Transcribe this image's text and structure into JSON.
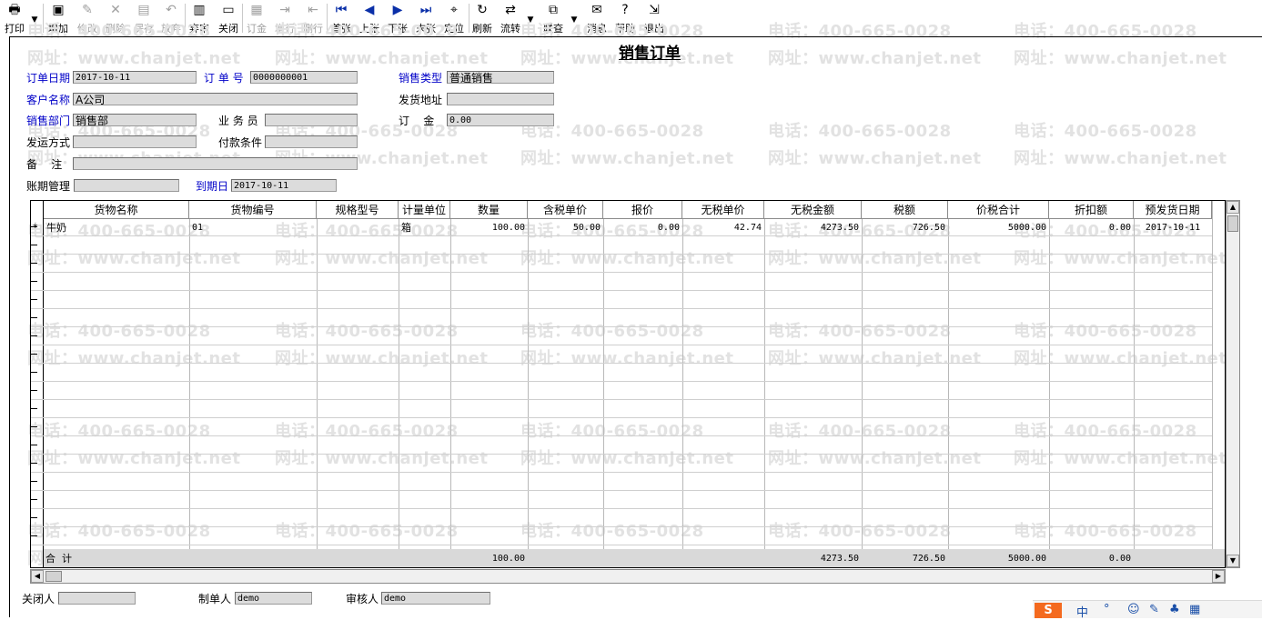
{
  "toolbar": {
    "buttons": [
      {
        "label": "打印",
        "icon": "printer-icon",
        "glyph": "🖶"
      },
      {
        "label": "增加",
        "icon": "add-doc-icon",
        "glyph": "▣"
      },
      {
        "label": "修改",
        "icon": "edit-icon",
        "glyph": "✎"
      },
      {
        "label": "删除",
        "icon": "delete-icon",
        "glyph": "✕"
      },
      {
        "label": "保存",
        "icon": "save-icon",
        "glyph": "▤"
      },
      {
        "label": "放弃",
        "icon": "undo-icon",
        "glyph": "↶"
      },
      {
        "label": "弃审",
        "icon": "unaudit-icon",
        "glyph": "▥"
      },
      {
        "label": "关闭",
        "icon": "open-folder-icon",
        "glyph": "▭"
      },
      {
        "label": "订金",
        "icon": "deposit-icon",
        "glyph": "▦"
      },
      {
        "label": "增行",
        "icon": "add-row-icon",
        "glyph": "⇥"
      },
      {
        "label": "删行",
        "icon": "delete-row-icon",
        "glyph": "⇤"
      },
      {
        "label": "首张",
        "icon": "first-record-icon",
        "glyph": "⏮"
      },
      {
        "label": "上张",
        "icon": "previous-record-icon",
        "glyph": "◀"
      },
      {
        "label": "下张",
        "icon": "next-record-icon",
        "glyph": "▶"
      },
      {
        "label": "末张",
        "icon": "last-record-icon",
        "glyph": "⏭"
      },
      {
        "label": "定位",
        "icon": "locate-icon",
        "glyph": "⌖"
      },
      {
        "label": "刷新",
        "icon": "refresh-icon",
        "glyph": "↻"
      },
      {
        "label": "流转",
        "icon": "flow-icon",
        "glyph": "⇄"
      },
      {
        "label": "联查",
        "icon": "query-icon",
        "glyph": "⧉"
      },
      {
        "label": "消息",
        "icon": "message-icon",
        "glyph": "✉"
      },
      {
        "label": "帮助",
        "icon": "help-icon",
        "glyph": "?"
      },
      {
        "label": "退出",
        "icon": "exit-icon",
        "glyph": "⇲"
      }
    ]
  },
  "watermark": {
    "phone": "电话：400-665-0028",
    "site": "网址：www.chanjet.net"
  },
  "form": {
    "title": "销售订单",
    "order_date_label": "订单日期",
    "order_date": "2017-10-11",
    "order_no_label": "订 单 号",
    "order_no": "0000000001",
    "sale_type_label": "销售类型",
    "sale_type": "普通销售",
    "customer_label": "客户名称",
    "customer": "A公司",
    "ship_addr_label": "发货地址",
    "ship_addr": "",
    "dept_label": "销售部门",
    "dept": "销售部",
    "salesman_label": "业 务 员",
    "salesman": "",
    "deposit_label": "订    金",
    "deposit": "0.00",
    "ship_method_label": "发运方式",
    "ship_method": "",
    "pay_terms_label": "付款条件",
    "pay_terms": "",
    "remark_label": "备    注",
    "remark": "",
    "account_label": "账期管理",
    "account": "",
    "due_date_label": "到期日",
    "due_date": "2017-10-11"
  },
  "grid": {
    "columns": [
      "货物名称",
      "货物编号",
      "规格型号",
      "计量单位",
      "数量",
      "含税单价",
      "报价",
      "无税单价",
      "无税金额",
      "税额",
      "价税合计",
      "折扣额",
      "预发货日期"
    ],
    "rows": [
      {
        "marker": "*",
        "cells": [
          "牛奶",
          "01",
          "",
          "箱",
          "100.00",
          "50.00",
          "0.00",
          "42.74",
          "4273.50",
          "726.50",
          "5000.00",
          "0.00",
          "2017-10-11"
        ]
      }
    ],
    "total": {
      "label": "合  计",
      "cells": [
        "",
        "",
        "",
        "",
        "100.00",
        "",
        "",
        "",
        "4273.50",
        "726.50",
        "5000.00",
        "0.00",
        ""
      ]
    }
  },
  "footer": {
    "closer_label": "关闭人",
    "closer": "",
    "maker_label": "制单人",
    "maker": "demo",
    "auditor_label": "审核人",
    "auditor": "demo"
  },
  "ime": {
    "logo": "S",
    "items": [
      "中",
      "°",
      "☺",
      "✎",
      "♣",
      "▦"
    ]
  }
}
